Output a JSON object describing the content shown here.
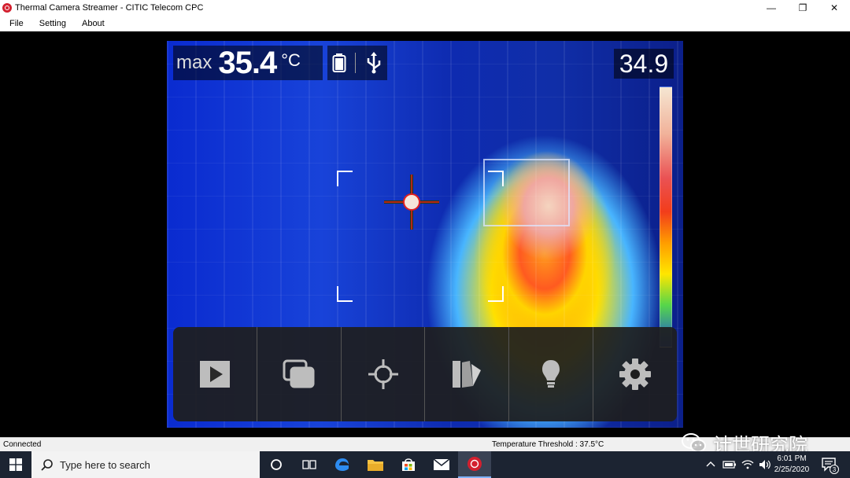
{
  "window": {
    "title": "Thermal Camera Streamer - CITIC Telecom CPC",
    "controls": {
      "minimize": "—",
      "restore": "❐",
      "close": "✕"
    }
  },
  "menu": {
    "items": [
      "File",
      "Setting",
      "About"
    ]
  },
  "thermal": {
    "max_label": "max",
    "max_value": "35.4",
    "max_unit": "°C",
    "spot_value": "34.9",
    "status_icons": [
      "battery-icon",
      "usb-icon"
    ],
    "palette_colors": [
      "#f5e6d2",
      "#ea5254",
      "#ff9d00",
      "#ffe600",
      "#56d64a",
      "#1a4de0"
    ]
  },
  "toolbar": {
    "buttons": [
      "play-icon",
      "gallery-icon",
      "spot-meter-icon",
      "palette-icon",
      "lamp-icon",
      "settings-icon"
    ]
  },
  "status_bar": {
    "connection": "Connected",
    "threshold": "Temperature Threshold : 37.5°C"
  },
  "watermark": {
    "text": "计世研究院"
  },
  "taskbar": {
    "search_placeholder": "Type here to search",
    "apps": [
      "cortana-icon",
      "task-view-icon",
      "edge-icon",
      "file-explorer-icon",
      "store-icon",
      "mail-icon",
      "thermal-app-icon"
    ],
    "time": "6:01 PM",
    "date": "2/25/2020",
    "notification_count": "3"
  }
}
